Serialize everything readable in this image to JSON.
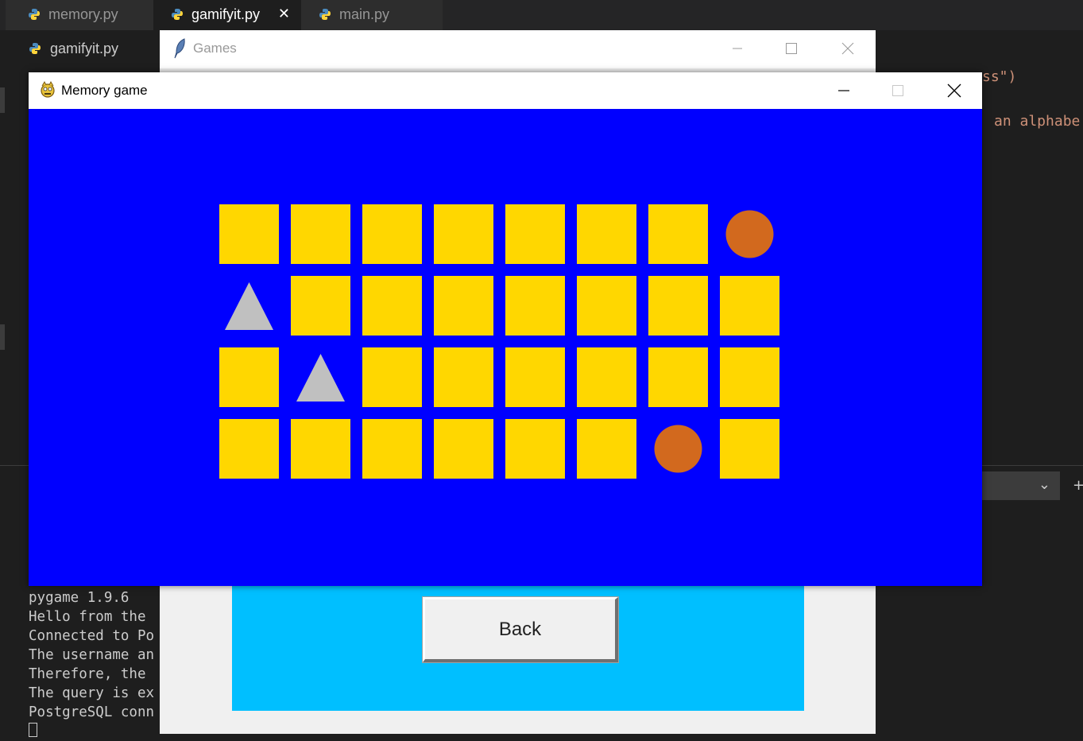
{
  "editor": {
    "tabs": [
      {
        "label": "memory.py",
        "active": false
      },
      {
        "label": "gamifyit.py",
        "active": true,
        "close": "✕"
      },
      {
        "label": "main.py",
        "active": false
      }
    ],
    "breadcrumb": "gamifyit.py",
    "code_fragments": [
      "ss\")",
      "an alphabe"
    ],
    "terminal_lines": [
      "pygame 1.9.6",
      "Hello from the",
      "Connected to Po",
      "The username an",
      "Therefore, the",
      "The query is ex",
      "PostgreSQL conn"
    ],
    "colors": {
      "background": "#1e1e1e",
      "string": "#ce9178"
    }
  },
  "games_window": {
    "title": "Games",
    "back_label": "Back",
    "panel_color": "#00bfff"
  },
  "memory_window": {
    "title": "Memory game",
    "background_color": "#0000ff",
    "tile_color": "#ffd700",
    "grid": {
      "rows": 4,
      "cols": 8,
      "revealed": [
        {
          "row": 0,
          "col": 7,
          "shape": "circle",
          "color": "#d2691e"
        },
        {
          "row": 1,
          "col": 0,
          "shape": "triangle",
          "color": "#c0c0c0"
        },
        {
          "row": 2,
          "col": 1,
          "shape": "triangle",
          "color": "#c0c0c0"
        },
        {
          "row": 3,
          "col": 6,
          "shape": "circle",
          "color": "#d2691e"
        }
      ]
    }
  }
}
